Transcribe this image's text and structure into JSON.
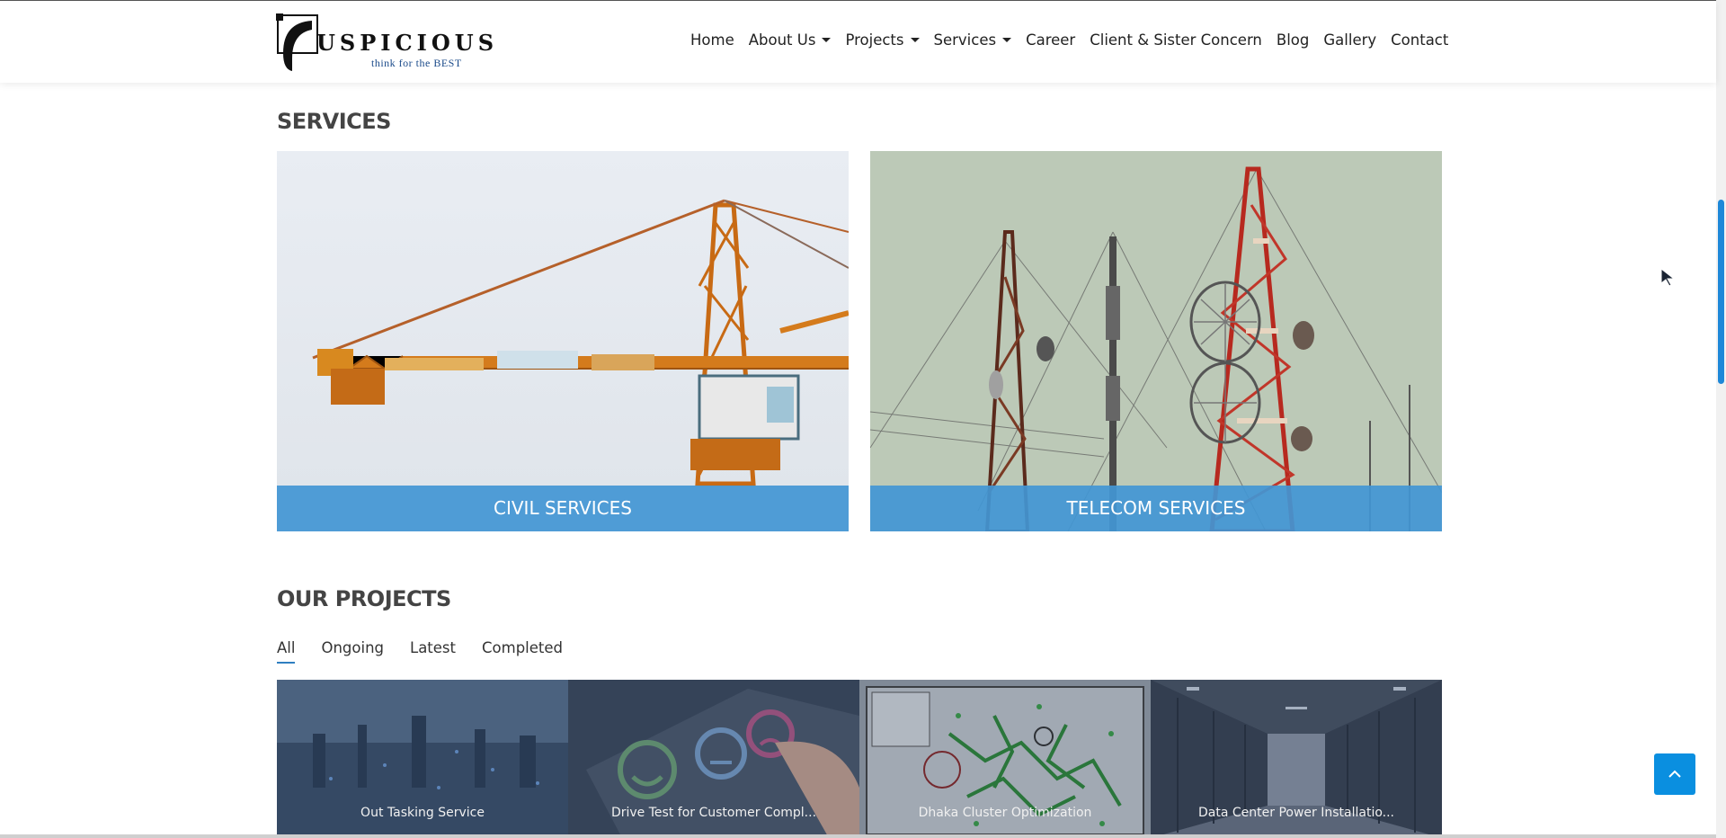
{
  "brand": {
    "name": "USPICIOUS",
    "tagline": "think for the BEST"
  },
  "nav": {
    "items": [
      {
        "label": "Home",
        "dropdown": false
      },
      {
        "label": "About Us",
        "dropdown": true
      },
      {
        "label": "Projects",
        "dropdown": true
      },
      {
        "label": "Services",
        "dropdown": true
      },
      {
        "label": "Career",
        "dropdown": false
      },
      {
        "label": "Client & Sister Concern",
        "dropdown": false
      },
      {
        "label": "Blog",
        "dropdown": false
      },
      {
        "label": "Gallery",
        "dropdown": false
      },
      {
        "label": "Contact",
        "dropdown": false
      }
    ]
  },
  "services": {
    "title": "SERVICES",
    "cards": [
      {
        "label": "CIVIL SERVICES",
        "image": "construction-crane"
      },
      {
        "label": "TELECOM SERVICES",
        "image": "telecom-towers"
      }
    ]
  },
  "projects": {
    "title": "OUR PROJECTS",
    "filters": [
      "All",
      "Ongoing",
      "Latest",
      "Completed"
    ],
    "active_filter": "All",
    "items": [
      {
        "label": "Out Tasking Service",
        "image": "city-network"
      },
      {
        "label": "Drive Test for Customer Compl...",
        "image": "feedback-smileys"
      },
      {
        "label": "Dhaka Cluster Optimization",
        "image": "network-map"
      },
      {
        "label": "Data Center Power Installatio...",
        "image": "server-room"
      }
    ]
  },
  "colors": {
    "accent": "#4296d4",
    "back_to_top": "#0a8fe0",
    "scroll_thumb": "#1e88d8"
  }
}
